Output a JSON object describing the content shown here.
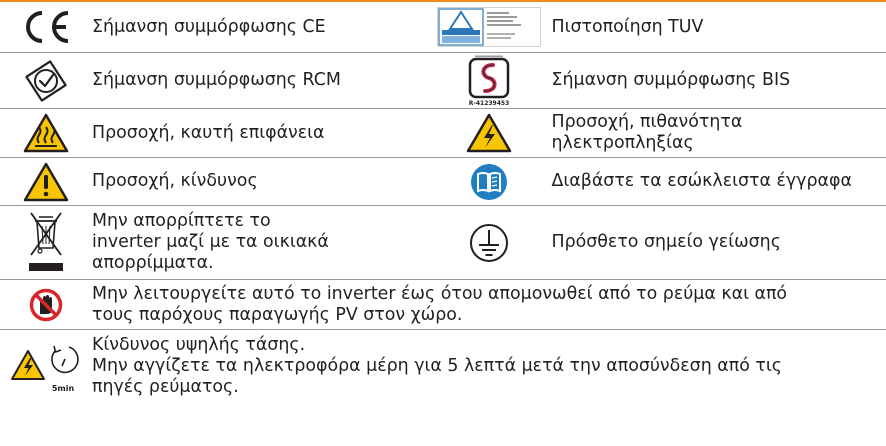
{
  "rows": [
    {
      "left": {
        "icon": "ce-mark-icon",
        "label": "Σήμανση συμμόρφωσης CE"
      },
      "right": {
        "icon": "tuv-certificate-icon",
        "label": "Πιστοποίηση TUV"
      }
    },
    {
      "left": {
        "icon": "rcm-mark-icon",
        "label": "Σήμανση συμμόρφωσης RCM"
      },
      "right": {
        "icon": "bis-mark-icon",
        "label": "Σήμανση συμμόρφωσης BIS",
        "icon_code": "R-41239453"
      }
    },
    {
      "left": {
        "icon": "hot-surface-warning-icon",
        "label": "Προσοχή, καυτή επιφάνεια"
      },
      "right": {
        "icon": "electric-shock-warning-icon",
        "label_lines": [
          "Προσοχή, πιθανότητα",
          "ηλεκτροπληξίας"
        ]
      }
    },
    {
      "left": {
        "icon": "general-danger-warning-icon",
        "label": "Προσοχή, κίνδυνος"
      },
      "right": {
        "icon": "read-manual-icon",
        "label": "Διαβάστε τα εσώκλειστα έγγραφα"
      }
    },
    {
      "left": {
        "icon": "weee-crossed-bin-icon",
        "label_lines": [
          "Μην απορρίπτετε το",
          "inverter μαζί με τα οικιακά",
          "απορρίμματα."
        ]
      },
      "right": {
        "icon": "ground-earth-icon",
        "label": "Πρόσθετο σημείο γείωσης"
      }
    },
    {
      "full": {
        "icon": "do-not-touch-icon",
        "label_lines": [
          "Μην λειτουργείτε αυτό το inverter έως ότου απομονωθεί από το ρεύμα και από",
          "τους παρόχους παραγωγής PV στον χώρο."
        ]
      }
    },
    {
      "full": {
        "icon": "high-voltage-5min-wait-icon",
        "icon_caption": "5min",
        "label_lines": [
          "Κίνδυνος υψηλής τάσης.",
          "Μην αγγίζετε τα ηλεκτροφόρα μέρη για 5 λεπτά μετά την αποσύνδεση από τις",
          "πηγές ρεύματος."
        ]
      }
    }
  ],
  "colors": {
    "accent_line": "#f08a1c",
    "warning_yellow": "#f7c600",
    "info_blue": "#1f7fc1",
    "prohibition_red": "#d9262b",
    "bis_blue": "#1b2f6e",
    "divider": "#9a9a9a"
  }
}
